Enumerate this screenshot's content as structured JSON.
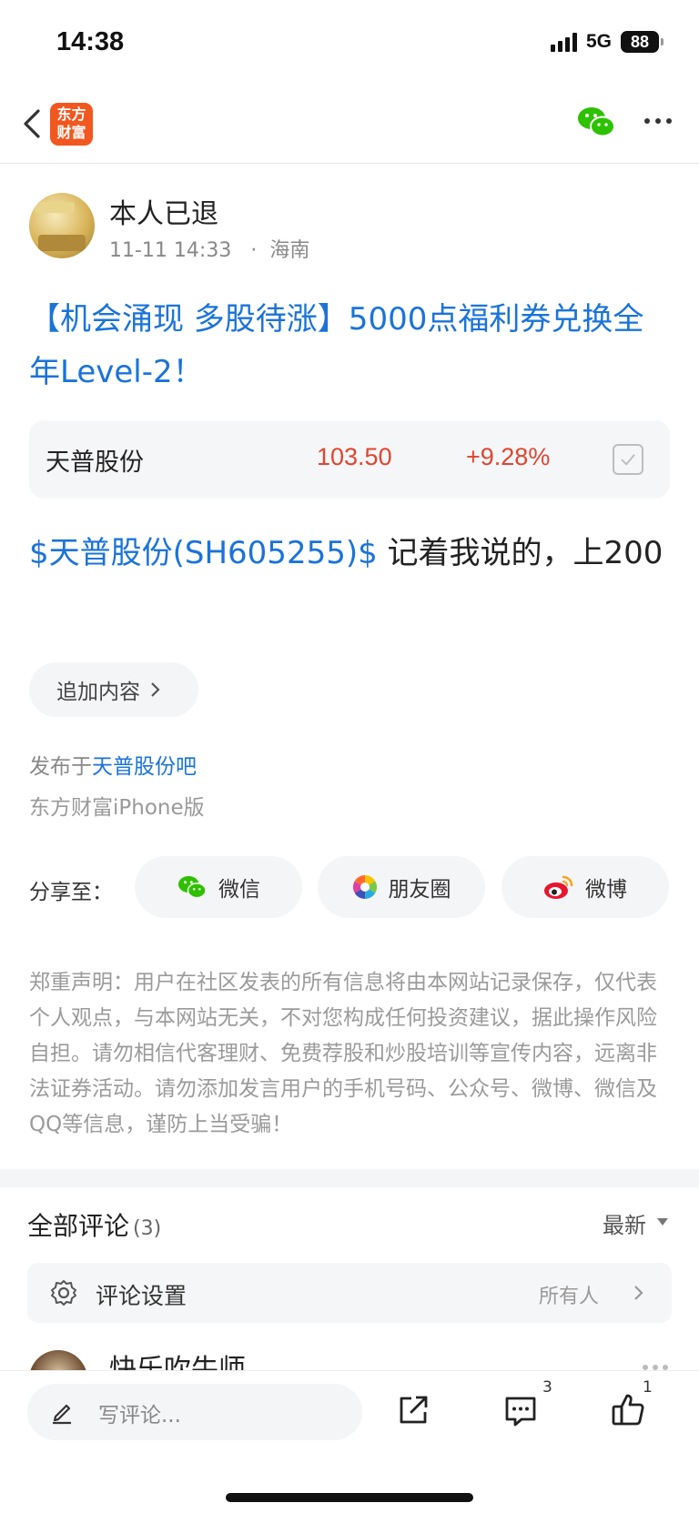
{
  "status_bar": {
    "time": "14:38",
    "network": "5G",
    "battery": "88"
  },
  "nav": {
    "logo_line1": "东方",
    "logo_line2": "财富"
  },
  "author": {
    "name": "本人已退",
    "date": "11-11 14:33",
    "location": "海南"
  },
  "post": {
    "title": "【机会涌现 多股待涨】5000点福利券兑换全年Level-2！",
    "stock_link": "$天普股份(SH605255)$",
    "body_text": " 记着我说的，上200",
    "append_label": "追加内容",
    "published_prefix": "发布于",
    "bar_name": "天普股份吧",
    "client": "东方财富iPhone版"
  },
  "stock_card": {
    "name": "天普股份",
    "price": "103.50",
    "change": "+9.28%"
  },
  "share": {
    "label": "分享至：",
    "wechat": "微信",
    "moments": "朋友圈",
    "weibo": "微博"
  },
  "disclaimer": "郑重声明：用户在社区发表的所有信息将由本网站记录保存，仅代表个人观点，与本网站无关，不对您构成任何投资建议，据此操作风险自担。请勿相信代客理财、免费荐股和炒股培训等宣传内容，远离非法证券活动。请勿添加发言用户的手机号码、公众号、微博、微信及QQ等信息，谨防上当受骗！",
  "comments": {
    "title": "全部评论",
    "count": "(3)",
    "sort": "最新",
    "settings_label": "评论设置",
    "settings_value": "所有人",
    "first_commenter": "快乐吹牛师"
  },
  "toolbar": {
    "write_placeholder": "写评论...",
    "comment_count": "3",
    "like_count": "1"
  },
  "colors": {
    "link_blue": "#1a73d9",
    "stock_red": "#e0452e",
    "brand_orange": "#f2571f"
  },
  "icons": [
    "back-icon",
    "wechat-icon",
    "more-icon",
    "checkbox-icon",
    "chevron-right-icon",
    "moments-icon",
    "weibo-icon",
    "gear-icon",
    "pen-icon",
    "share-icon",
    "comment-icon",
    "like-icon"
  ]
}
